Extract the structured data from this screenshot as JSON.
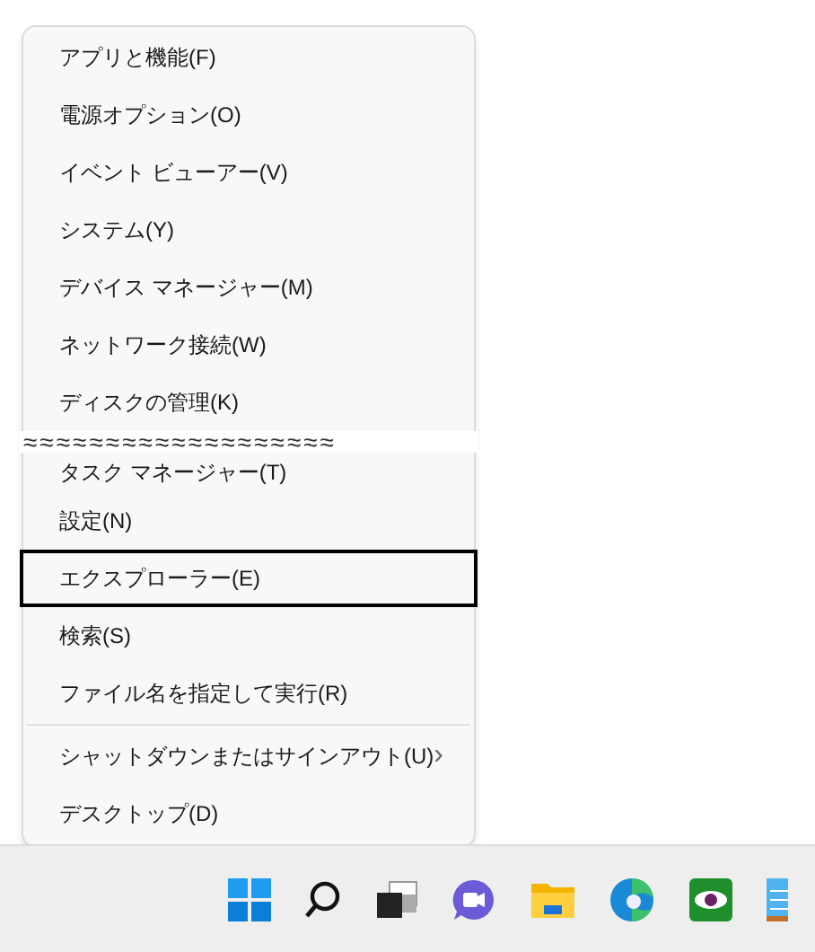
{
  "menu": {
    "items": [
      {
        "kind": "item",
        "label": "アプリと機能(F)",
        "selected": false
      },
      {
        "kind": "item",
        "label": "電源オプション(O)",
        "selected": false
      },
      {
        "kind": "item",
        "label": "イベント ビューアー(V)",
        "selected": false
      },
      {
        "kind": "item",
        "label": "システム(Y)",
        "selected": false
      },
      {
        "kind": "item",
        "label": "デバイス マネージャー(M)",
        "selected": false
      },
      {
        "kind": "item",
        "label": "ネットワーク接続(W)",
        "selected": false
      },
      {
        "kind": "item",
        "label": "ディスクの管理(K)",
        "selected": false
      },
      {
        "kind": "break",
        "label": "≈≈≈≈≈≈≈≈≈≈≈≈≈≈≈≈≈≈≈"
      },
      {
        "kind": "cut",
        "label": "タスク マネージャー(T)",
        "selected": false
      },
      {
        "kind": "item",
        "label": "設定(N)",
        "selected": false
      },
      {
        "kind": "item",
        "label": "エクスプローラー(E)",
        "selected": true
      },
      {
        "kind": "item",
        "label": "検索(S)",
        "selected": false
      },
      {
        "kind": "item",
        "label": "ファイル名を指定して実行(R)",
        "selected": false
      },
      {
        "kind": "separator"
      },
      {
        "kind": "submenu",
        "label": "シャットダウンまたはサインアウト(U)",
        "arrow": "›",
        "selected": false
      },
      {
        "kind": "item",
        "label": "デスクトップ(D)",
        "selected": false
      }
    ]
  },
  "taskbar": {
    "icons": [
      {
        "kind": "start"
      },
      {
        "kind": "search"
      },
      {
        "kind": "task-view"
      },
      {
        "kind": "chat"
      },
      {
        "kind": "folder"
      },
      {
        "kind": "browser"
      },
      {
        "kind": "eye"
      },
      {
        "kind": "notepad"
      }
    ]
  }
}
